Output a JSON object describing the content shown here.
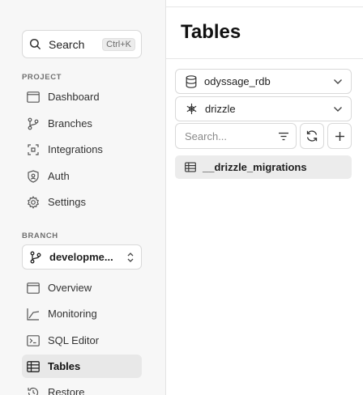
{
  "search": {
    "label": "Search",
    "shortcut": "Ctrl+K"
  },
  "sidebar": {
    "project_label": "PROJECT",
    "project_items": [
      {
        "label": "Dashboard",
        "icon": "dashboard-icon"
      },
      {
        "label": "Branches",
        "icon": "branches-icon"
      },
      {
        "label": "Integrations",
        "icon": "integrations-icon"
      },
      {
        "label": "Auth",
        "icon": "auth-icon"
      },
      {
        "label": "Settings",
        "icon": "settings-icon"
      }
    ],
    "branch_label": "BRANCH",
    "branch_selected": "developme...",
    "branch_items": [
      {
        "label": "Overview",
        "icon": "overview-icon"
      },
      {
        "label": "Monitoring",
        "icon": "monitoring-icon"
      },
      {
        "label": "SQL Editor",
        "icon": "sql-editor-icon"
      },
      {
        "label": "Tables",
        "icon": "tables-icon",
        "active": true
      },
      {
        "label": "Restore",
        "icon": "restore-icon"
      }
    ]
  },
  "main": {
    "title": "Tables",
    "database_select": "odyssage_rdb",
    "schema_select": "drizzle",
    "filter_placeholder": "Search...",
    "tables": [
      {
        "name": "__drizzle_migrations"
      }
    ]
  },
  "colors": {
    "active_bg": "#e8e8e8",
    "sidebar_bg": "#f7f7f7",
    "border": "#d9d9d9"
  }
}
